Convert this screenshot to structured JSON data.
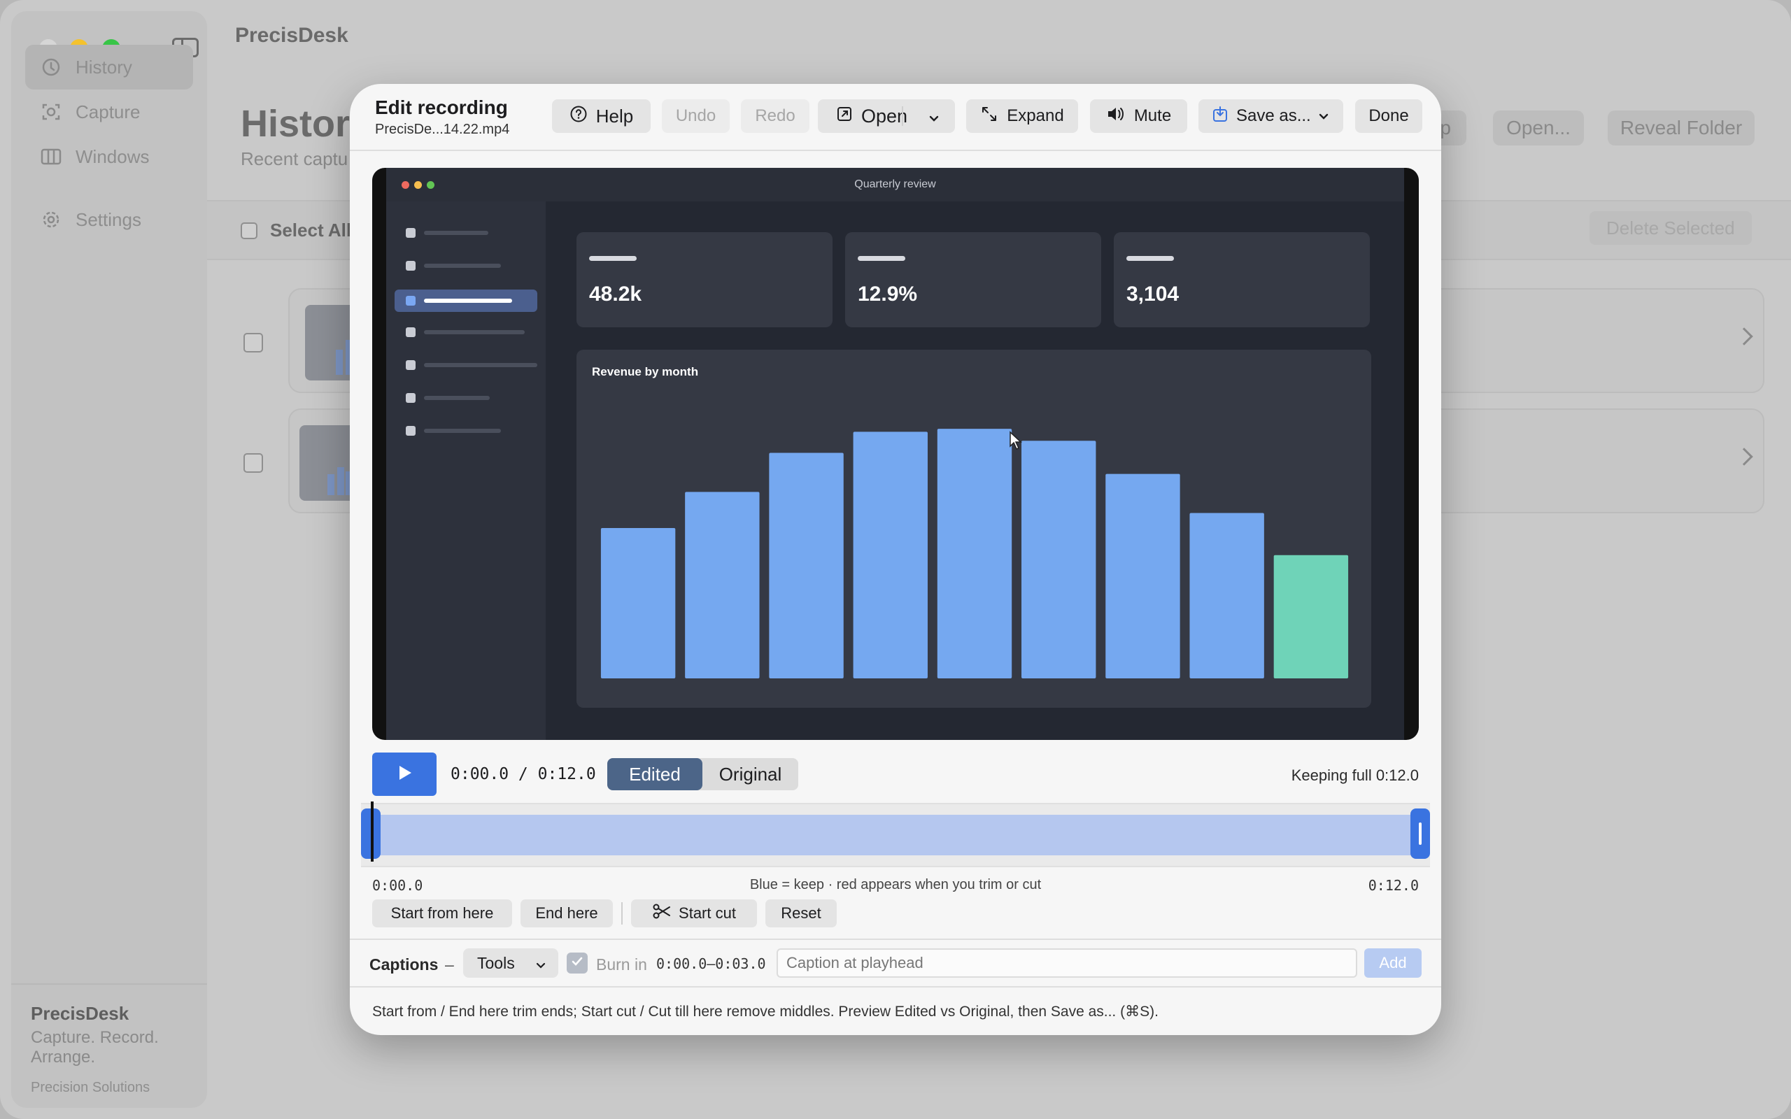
{
  "app": {
    "title": "PrecisDesk"
  },
  "sidebar": {
    "items": [
      {
        "label": "History",
        "icon": "clock-icon",
        "active": true
      },
      {
        "label": "Capture",
        "icon": "capture-icon"
      },
      {
        "label": "Windows",
        "icon": "windows-icon"
      },
      {
        "label": "Settings",
        "icon": "gear-icon"
      }
    ],
    "brand": "PrecisDesk",
    "tagline": "Capture. Record. Arrange.",
    "company": "Precision Solutions"
  },
  "content": {
    "title": "History",
    "subtitle": "Recent captu",
    "header_buttons": {
      "partial": "p",
      "open": "Open...",
      "reveal": "Reveal Folder"
    },
    "select_all": "Select All",
    "delete_selected": "Delete Selected"
  },
  "modal": {
    "title": "Edit recording",
    "filename": "PrecisDe...14.22.mp4",
    "buttons": {
      "help": "Help",
      "undo": "Undo",
      "redo": "Redo",
      "open": "Open",
      "expand": "Expand",
      "mute": "Mute",
      "save_as": "Save as...",
      "done": "Done"
    },
    "preview": {
      "window_title": "Quarterly review",
      "stats": [
        "48.2k",
        "12.9%",
        "3,104"
      ],
      "chart_title": "Revenue by month"
    },
    "playback": {
      "time": "0:00.0 / 0:12.0",
      "segments": {
        "edited": "Edited",
        "original": "Original",
        "selected": "Edited"
      },
      "keep_status": "Keeping full 0:12.0"
    },
    "timeline": {
      "start": "0:00.0",
      "end": "0:12.0",
      "hint": "Blue = keep · red appears when you trim or cut",
      "keep_fraction": 1.0,
      "playhead_fraction": 0.0
    },
    "actions": {
      "start_here": "Start from here",
      "end_here": "End here",
      "start_cut": "Start cut",
      "reset": "Reset"
    },
    "captions": {
      "label": "Captions",
      "dash": "–",
      "tools": "Tools",
      "burn_in": "Burn in",
      "burn_in_checked": true,
      "range": "0:00.0–0:03.0",
      "placeholder": "Caption at playhead",
      "add": "Add"
    },
    "footer": "Start from / End here trim ends; Start cut / Cut till here remove middles. Preview Edited vs Original, then Save as... (⌘S)."
  },
  "colors": {
    "accent": "#3a73e0",
    "bar": "#75a8f0",
    "bar_highlight": "#6fd3b8",
    "keep": "#b5c7ef"
  },
  "chart_data": {
    "type": "bar",
    "title": "Revenue by month",
    "categories": [
      "",
      "",
      "",
      "",
      "",
      "",
      "",
      "",
      ""
    ],
    "values": [
      50,
      62,
      75,
      82,
      83,
      79,
      68,
      55,
      41
    ],
    "highlight_index": 8,
    "ylim": [
      0,
      100
    ],
    "grid": false
  }
}
